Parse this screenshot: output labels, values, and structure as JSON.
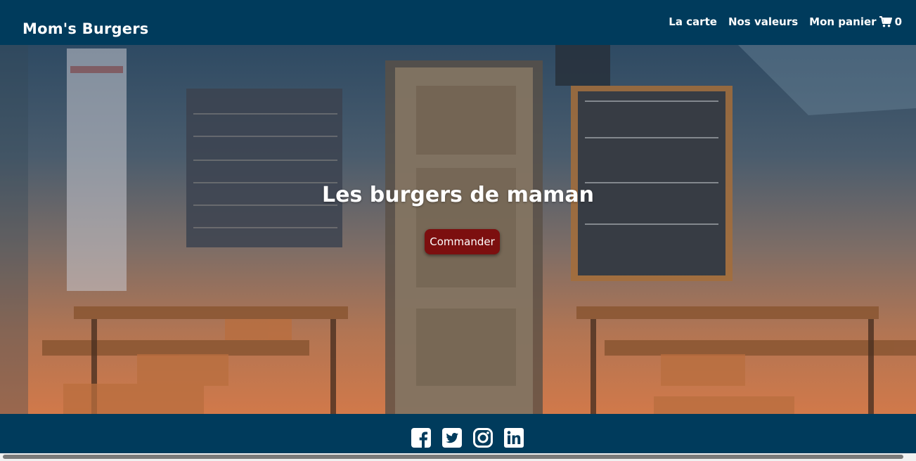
{
  "brand": {
    "name": "Mom's Burgers"
  },
  "nav": {
    "items": [
      {
        "label": "La carte"
      },
      {
        "label": "Nos valeurs"
      },
      {
        "label": "Mon panier",
        "icon": "cart-icon",
        "count": "0"
      }
    ]
  },
  "hero": {
    "title": "Les burgers de maman",
    "button_label": "Commander",
    "background": "restaurant interior photo with blue-to-orange gradient overlay"
  },
  "footer": {
    "social_icons": [
      "facebook-icon",
      "twitter-icon",
      "instagram-icon",
      "linkedin-icon"
    ]
  },
  "colors": {
    "nav_bg": "#003b5c",
    "footer_bg": "#003b5c",
    "button_bg": "#7c0f0f",
    "overlay_top": "#2e4a63",
    "overlay_bottom": "#d1794a",
    "text": "#ffffff"
  }
}
